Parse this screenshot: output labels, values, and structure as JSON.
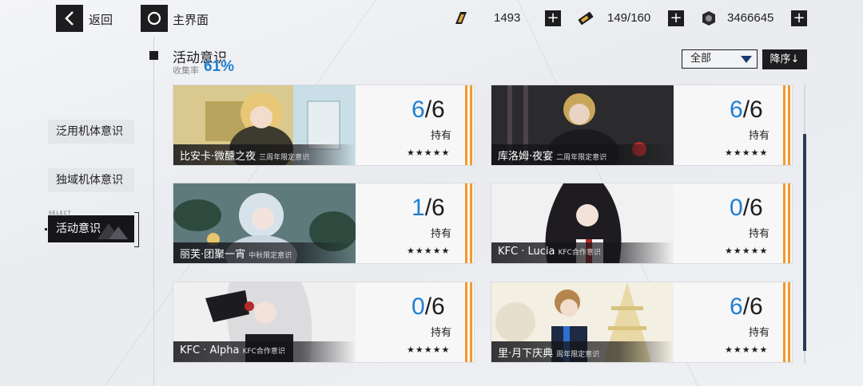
{
  "topbar": {
    "back_label": "返回",
    "home_label": "主界面",
    "resources": [
      {
        "icon": "gold-bar-icon",
        "value": "1493"
      },
      {
        "icon": "battery-icon",
        "value": "149/160"
      },
      {
        "icon": "cog-coin-icon",
        "value": "3466645"
      }
    ]
  },
  "sidebar": {
    "items": [
      {
        "label": "泛用机体意识"
      },
      {
        "label": "独域机体意识"
      },
      {
        "label": "活动意识",
        "tag": "SELECT"
      }
    ]
  },
  "header": {
    "title": "活动意识",
    "rate_label": "收集率",
    "rate_value": "61%"
  },
  "controls": {
    "filter_value": "全部",
    "sort_label": "降序↓"
  },
  "cards": [
    {
      "name": "比安卡·微醺之夜",
      "tag": "三周年限定意识",
      "current": "6",
      "total": "/6",
      "held_label": "持有",
      "stars": "★★★★★"
    },
    {
      "name": "库洛姆·夜宴",
      "tag": "二周年限定意识",
      "current": "6",
      "total": "/6",
      "held_label": "持有",
      "stars": "★★★★★"
    },
    {
      "name": "丽芙·团聚一宵",
      "tag": "中秋限定意识",
      "current": "1",
      "total": "/6",
      "held_label": "持有",
      "stars": "★★★★★"
    },
    {
      "name": "KFC · Lucia",
      "tag": "KFC合作意识",
      "current": "0",
      "total": "/6",
      "held_label": "持有",
      "stars": "★★★★★"
    },
    {
      "name": "KFC · Alpha",
      "tag": "KFC合作意识",
      "current": "0",
      "total": "/6",
      "held_label": "持有",
      "stars": "★★★★★"
    },
    {
      "name": "里·月下庆典",
      "tag": "周年限定意识",
      "current": "6",
      "total": "/6",
      "held_label": "持有",
      "stars": "★★★★★"
    }
  ],
  "colors": {
    "accent_blue": "#1f7fd0",
    "stripe_orange": "#f39a2c",
    "dark": "#1d1d1f"
  }
}
